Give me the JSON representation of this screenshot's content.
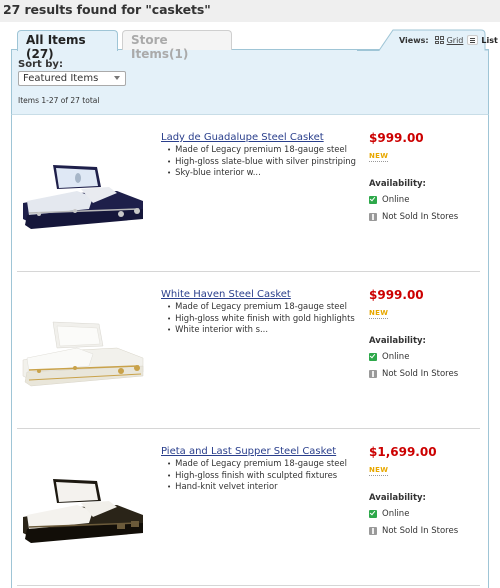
{
  "header": {
    "results_title": "27 results found for \"caskets\""
  },
  "tabs": [
    {
      "label": "All Items (27)",
      "active": true
    },
    {
      "label": "Store Items(1)",
      "active": false
    }
  ],
  "views": {
    "label": "Views:",
    "grid_label": "Grid",
    "list_label": "List",
    "selected": "List"
  },
  "sort": {
    "label": "Sort by:",
    "selected": "Featured Items"
  },
  "items_count": "Items 1-27 of 27 total",
  "products": [
    {
      "title": "Lady de Guadalupe Steel Casket",
      "features": [
        "Made of Legacy premium 18-gauge steel",
        "High-gloss slate-blue with silver pinstriping",
        "Sky-blue interior w..."
      ],
      "price": "$999.00",
      "badge": "NEW",
      "availability_label": "Availability:",
      "online": "Online",
      "stores": "Not Sold In Stores",
      "image": "slate-blue-casket-image",
      "colors": {
        "body": "#1e1f4a",
        "interior": "#dfe8f5",
        "trim": "#b8b8b8"
      }
    },
    {
      "title": "White Haven Steel Casket",
      "features": [
        "Made of Legacy premium 18-gauge steel",
        "High-gloss white finish with gold highlights",
        "White interior with s..."
      ],
      "price": "$999.00",
      "badge": "NEW",
      "availability_label": "Availability:",
      "online": "Online",
      "stores": "Not Sold In Stores",
      "image": "white-casket-image",
      "colors": {
        "body": "#f2f1ec",
        "interior": "#f8f8f6",
        "trim": "#c9a24a"
      }
    },
    {
      "title": "Pieta and Last Supper Steel Casket",
      "features": [
        "Made of Legacy premium 18-gauge steel",
        "High-gloss finish with sculpted fixtures",
        "Hand-knit velvet interior"
      ],
      "price": "$1,699.00",
      "badge": "NEW",
      "availability_label": "Availability:",
      "online": "Online",
      "stores": "Not Sold In Stores",
      "image": "bronze-casket-image",
      "colors": {
        "body": "#2a2418",
        "interior": "#f4f2ee",
        "trim": "#6b5a3a"
      }
    }
  ]
}
